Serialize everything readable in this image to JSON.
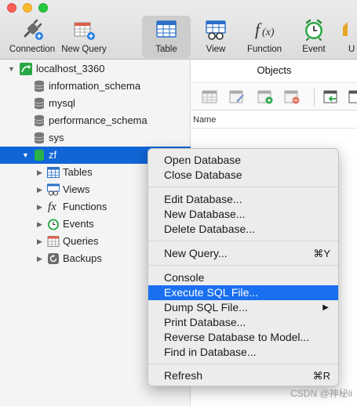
{
  "toolbar": {
    "buttons": [
      {
        "label": "Connection",
        "icon": "connection-plug-icon"
      },
      {
        "label": "New Query",
        "icon": "new-query-icon"
      },
      {
        "label": "Table",
        "icon": "table-icon"
      },
      {
        "label": "View",
        "icon": "view-icon"
      },
      {
        "label": "Function",
        "icon": "function-icon"
      },
      {
        "label": "Event",
        "icon": "event-clock-icon"
      },
      {
        "label": "U"
      }
    ]
  },
  "tree": {
    "connection": "localhost_3360",
    "databases": [
      "information_schema",
      "mysql",
      "performance_schema",
      "sys"
    ],
    "selected_db": "zf",
    "children": [
      "Tables",
      "Views",
      "Functions",
      "Events",
      "Queries",
      "Backups"
    ],
    "function_glyph": "fx"
  },
  "objects": {
    "title": "Objects",
    "column_name": "Name"
  },
  "context_menu": {
    "groups": [
      [
        {
          "label": "Open Database"
        },
        {
          "label": "Close Database"
        }
      ],
      [
        {
          "label": "Edit Database..."
        },
        {
          "label": "New Database..."
        },
        {
          "label": "Delete Database..."
        }
      ],
      [
        {
          "label": "New Query...",
          "shortcut": "⌘Y"
        }
      ],
      [
        {
          "label": "Console"
        },
        {
          "label": "Execute SQL File..."
        },
        {
          "label": "Dump SQL File...",
          "submenu": true
        },
        {
          "label": "Print Database..."
        },
        {
          "label": "Reverse Database to Model..."
        },
        {
          "label": "Find in Database..."
        }
      ],
      [
        {
          "label": "Refresh",
          "shortcut": "⌘R"
        }
      ]
    ],
    "highlighted": "Execute SQL File..."
  },
  "watermark": "CSDN @神秘li",
  "colors": {
    "selection": "#1166d7",
    "menu_highlight": "#1a6ff0",
    "db_green": "#29b24a"
  }
}
